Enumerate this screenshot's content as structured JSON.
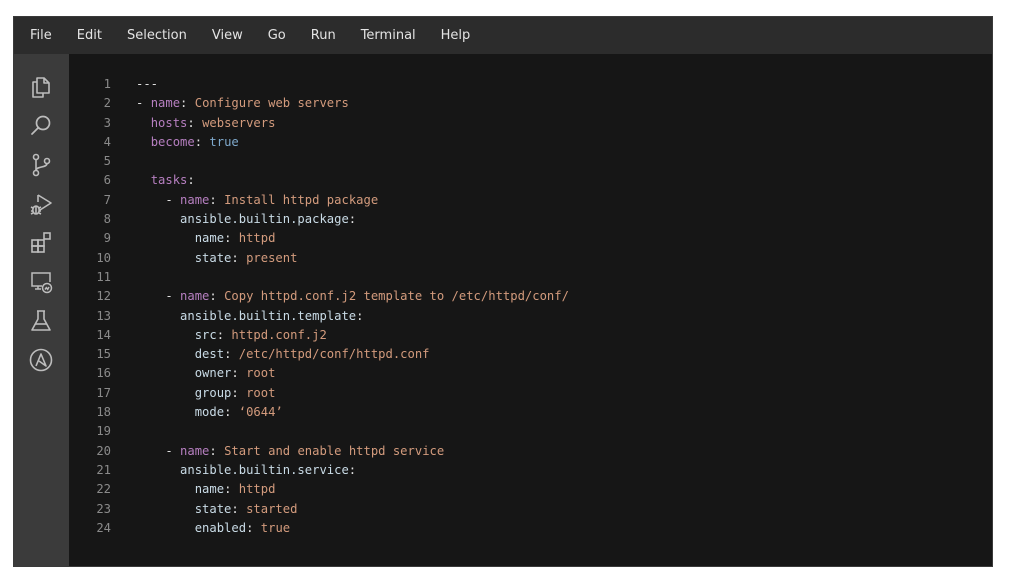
{
  "menubar": {
    "items": [
      "File",
      "Edit",
      "Selection",
      "View",
      "Go",
      "Run",
      "Terminal",
      "Help"
    ]
  },
  "activity_bar": {
    "icons": [
      "explorer-icon",
      "search-icon",
      "source-control-icon",
      "run-debug-icon",
      "extensions-icon",
      "remote-explorer-icon",
      "testing-icon",
      "ansible-icon"
    ]
  },
  "colors": {
    "key_top": "#b67fc0",
    "key_inner": "#c9dbe6",
    "string_value": "#d39b7d",
    "bool_value": "#7fa9cc",
    "line_number": "#8a8a8a",
    "editor_bg": "#161616",
    "activity_bg": "#3b3b3b",
    "menubar_bg": "#2c2c2c"
  },
  "editor": {
    "lines": [
      {
        "n": "1",
        "tokens": [
          {
            "t": "---",
            "c": "punc"
          }
        ]
      },
      {
        "n": "2",
        "tokens": [
          {
            "t": "- ",
            "c": "punc"
          },
          {
            "t": "name",
            "c": "k-top"
          },
          {
            "t": ": ",
            "c": "punc"
          },
          {
            "t": "Configure web servers",
            "c": "v-str"
          }
        ]
      },
      {
        "n": "3",
        "tokens": [
          {
            "t": "  ",
            "c": "punc"
          },
          {
            "t": "hosts",
            "c": "k-top"
          },
          {
            "t": ": ",
            "c": "punc"
          },
          {
            "t": "webservers",
            "c": "v-str"
          }
        ]
      },
      {
        "n": "4",
        "tokens": [
          {
            "t": "  ",
            "c": "punc"
          },
          {
            "t": "become",
            "c": "k-top"
          },
          {
            "t": ": ",
            "c": "punc"
          },
          {
            "t": "true",
            "c": "v-bool"
          }
        ]
      },
      {
        "n": "5",
        "tokens": []
      },
      {
        "n": "6",
        "tokens": [
          {
            "t": "  ",
            "c": "punc"
          },
          {
            "t": "tasks",
            "c": "k-top"
          },
          {
            "t": ":",
            "c": "punc"
          }
        ]
      },
      {
        "n": "7",
        "tokens": [
          {
            "t": "    - ",
            "c": "punc"
          },
          {
            "t": "name",
            "c": "k-top"
          },
          {
            "t": ": ",
            "c": "punc"
          },
          {
            "t": "Install httpd package",
            "c": "v-str"
          }
        ]
      },
      {
        "n": "8",
        "tokens": [
          {
            "t": "      ",
            "c": "punc"
          },
          {
            "t": "ansible.builtin.package",
            "c": "k-in"
          },
          {
            "t": ":",
            "c": "punc"
          }
        ]
      },
      {
        "n": "9",
        "tokens": [
          {
            "t": "        ",
            "c": "punc"
          },
          {
            "t": "name",
            "c": "k-in"
          },
          {
            "t": ": ",
            "c": "punc"
          },
          {
            "t": "httpd",
            "c": "v-str"
          }
        ]
      },
      {
        "n": "10",
        "tokens": [
          {
            "t": "        ",
            "c": "punc"
          },
          {
            "t": "state",
            "c": "k-in"
          },
          {
            "t": ": ",
            "c": "punc"
          },
          {
            "t": "present",
            "c": "v-str"
          }
        ]
      },
      {
        "n": "11",
        "tokens": []
      },
      {
        "n": "12",
        "tokens": [
          {
            "t": "    - ",
            "c": "punc"
          },
          {
            "t": "name",
            "c": "k-top"
          },
          {
            "t": ": ",
            "c": "punc"
          },
          {
            "t": "Copy httpd.conf.j2 template to /etc/httpd/conf/",
            "c": "v-str"
          }
        ]
      },
      {
        "n": "13",
        "tokens": [
          {
            "t": "      ",
            "c": "punc"
          },
          {
            "t": "ansible.builtin.template",
            "c": "k-in"
          },
          {
            "t": ":",
            "c": "punc"
          }
        ]
      },
      {
        "n": "14",
        "tokens": [
          {
            "t": "        ",
            "c": "punc"
          },
          {
            "t": "src",
            "c": "k-in"
          },
          {
            "t": ": ",
            "c": "punc"
          },
          {
            "t": "httpd.conf.j2",
            "c": "v-str"
          }
        ]
      },
      {
        "n": "15",
        "tokens": [
          {
            "t": "        ",
            "c": "punc"
          },
          {
            "t": "dest",
            "c": "k-in"
          },
          {
            "t": ": ",
            "c": "punc"
          },
          {
            "t": "/etc/httpd/conf/httpd.conf",
            "c": "v-str"
          }
        ]
      },
      {
        "n": "16",
        "tokens": [
          {
            "t": "        ",
            "c": "punc"
          },
          {
            "t": "owner",
            "c": "k-in"
          },
          {
            "t": ": ",
            "c": "punc"
          },
          {
            "t": "root",
            "c": "v-str"
          }
        ]
      },
      {
        "n": "17",
        "tokens": [
          {
            "t": "        ",
            "c": "punc"
          },
          {
            "t": "group",
            "c": "k-in"
          },
          {
            "t": ": ",
            "c": "punc"
          },
          {
            "t": "root",
            "c": "v-str"
          }
        ]
      },
      {
        "n": "18",
        "tokens": [
          {
            "t": "        ",
            "c": "punc"
          },
          {
            "t": "mode",
            "c": "k-in"
          },
          {
            "t": ": ",
            "c": "punc"
          },
          {
            "t": "‘0644’",
            "c": "v-str"
          }
        ]
      },
      {
        "n": "19",
        "tokens": []
      },
      {
        "n": "20",
        "tokens": [
          {
            "t": "    - ",
            "c": "punc"
          },
          {
            "t": "name",
            "c": "k-top"
          },
          {
            "t": ": ",
            "c": "punc"
          },
          {
            "t": "Start and enable httpd service",
            "c": "v-str"
          }
        ]
      },
      {
        "n": "21",
        "tokens": [
          {
            "t": "      ",
            "c": "punc"
          },
          {
            "t": "ansible.builtin.service",
            "c": "k-in"
          },
          {
            "t": ":",
            "c": "punc"
          }
        ]
      },
      {
        "n": "22",
        "tokens": [
          {
            "t": "        ",
            "c": "punc"
          },
          {
            "t": "name",
            "c": "k-in"
          },
          {
            "t": ": ",
            "c": "punc"
          },
          {
            "t": "httpd",
            "c": "v-str"
          }
        ]
      },
      {
        "n": "23",
        "tokens": [
          {
            "t": "        ",
            "c": "punc"
          },
          {
            "t": "state",
            "c": "k-in"
          },
          {
            "t": ": ",
            "c": "punc"
          },
          {
            "t": "started",
            "c": "v-str"
          }
        ]
      },
      {
        "n": "24",
        "tokens": [
          {
            "t": "        ",
            "c": "punc"
          },
          {
            "t": "enabled",
            "c": "k-in"
          },
          {
            "t": ": ",
            "c": "punc"
          },
          {
            "t": "true",
            "c": "v-str"
          }
        ]
      }
    ]
  }
}
